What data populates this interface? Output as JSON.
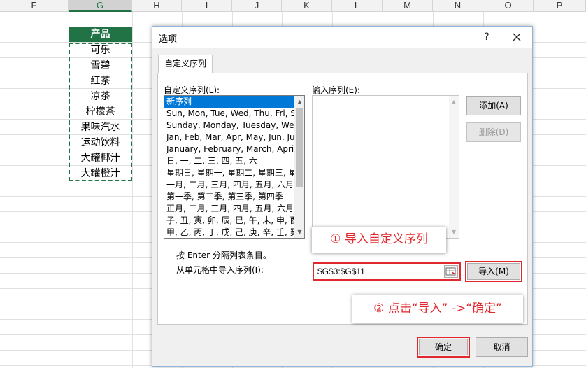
{
  "sheet": {
    "columns": [
      "F",
      "G",
      "H",
      "I",
      "J",
      "K",
      "L",
      "M",
      "N",
      "O",
      "P"
    ],
    "header_cell": "产品",
    "products": [
      "可乐",
      "雪碧",
      "红茶",
      "凉茶",
      "柠檬茶",
      "果味汽水",
      "运动饮料",
      "大罐椰汁",
      "大罐橙汁"
    ],
    "accent": "#217346"
  },
  "dialog": {
    "title": "选项",
    "help": "?",
    "tab_label": "自定义序列",
    "custom_lists_label": "自定义序列(L):",
    "entries_label": "输入序列(E):",
    "custom_lists": [
      "新序列",
      "Sun, Mon, Tue, Wed, Thu, Fri, Sat",
      "Sunday, Monday, Tuesday, Wednesday",
      "Jan, Feb, Mar, Apr, May, Jun, Jul",
      "January, February, March, April",
      "日, 一, 二, 三, 四, 五, 六",
      "星期日, 星期一, 星期二, 星期三, 星期四",
      "一月, 二月, 三月, 四月, 五月, 六月",
      "第一季, 第二季, 第三季, 第四季",
      "正月, 二月, 三月, 四月, 五月, 六月",
      "子, 丑, 寅, 卯, 辰, 巳, 午, 未, 申, 酉",
      "甲, 乙, 丙, 丁, 戊, 己, 庚, 辛, 壬, 癸"
    ],
    "add_button": "添加(A)",
    "delete_button": "删除(D)",
    "hint": "按 Enter 分隔列表条目。",
    "import_label": "从单元格中导入序列(I):",
    "import_value": "$G$3:$G$11",
    "import_button": "导入(M)",
    "ok_button": "确定",
    "cancel_button": "取消",
    "highlight_color": "#e0282e"
  },
  "callouts": {
    "step1": "① 导入自定义序列",
    "step2": "② 点击“导入” ->“确定”"
  }
}
